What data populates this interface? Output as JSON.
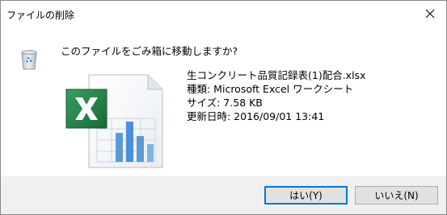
{
  "window": {
    "title": "ファイルの削除",
    "close_glyph": "✕"
  },
  "dialog": {
    "question": "このファイルをごみ箱に移動しますか?",
    "file": {
      "name": "生コンクリート品質記録表(1)配合.xlsx",
      "type_line": "種類: Microsoft Excel ワークシート",
      "size_line": "サイズ: 7.58 KB",
      "modified_line": "更新日時: 2016/09/01 13:41"
    },
    "icons": {
      "dialog_icon": "recycle-bin-icon",
      "file_icon": "excel-file-icon"
    }
  },
  "buttons": {
    "yes_label": "はい(Y)",
    "no_label": "いいえ(N)"
  },
  "colors": {
    "focus_border": "#0078d7",
    "footer_bg": "#f0f0f0",
    "excel_green": "#1e7145",
    "chart_blue": "#4a90d9"
  }
}
